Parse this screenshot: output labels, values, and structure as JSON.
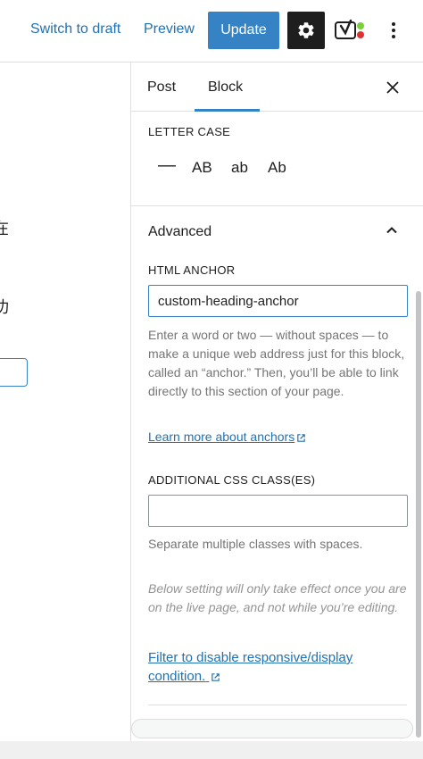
{
  "topbar": {
    "switch_to_draft": "Switch to draft",
    "preview": "Preview",
    "update": "Update",
    "settings_icon": "gear-icon",
    "plugin_icon": "yoast-icon",
    "more_icon": "more-vertical-icon"
  },
  "editor": {
    "fragment_1": "在",
    "fragment_2": "功"
  },
  "sidebar": {
    "tabs": {
      "post": "Post",
      "block": "Block"
    },
    "letter_case": {
      "label": "LETTER CASE",
      "options": [
        "—",
        "AB",
        "ab",
        "Ab"
      ]
    },
    "advanced": {
      "title": "Advanced",
      "html_anchor": {
        "label": "HTML ANCHOR",
        "value": "custom-heading-anchor",
        "help": "Enter a word or two — without spaces — to make a unique web address just for this block, called an “anchor.” Then, you’ll be able to link directly to this section of your page.",
        "learn_more": "Learn more about anchors"
      },
      "css_classes": {
        "label": "ADDITIONAL CSS CLASS(ES)",
        "value": "",
        "help": "Separate multiple classes with spaces."
      },
      "note": "Below setting will only take effect once you are on the live page, and not while you’re editing.",
      "filter_link": "Filter to disable responsive/display condition."
    }
  },
  "colors": {
    "accent": "#3582c4",
    "link": "#2271b1",
    "text": "#1e1e1e",
    "muted": "#757575"
  }
}
